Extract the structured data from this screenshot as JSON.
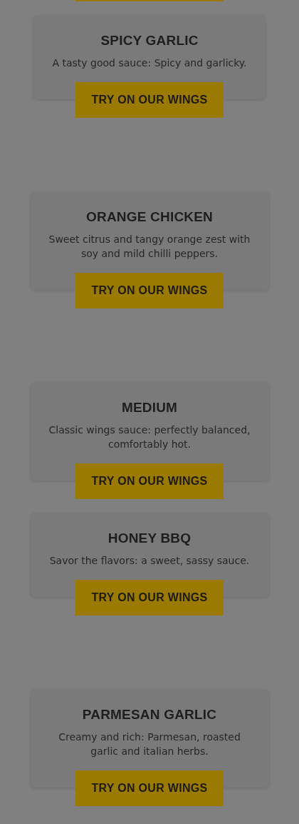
{
  "sauces": [
    {
      "name": "SPICY GARLIC",
      "description": "A tasty good sauce: Spicy and garlicky.",
      "button": "TRY ON OUR WINGS"
    },
    {
      "name": "ORANGE CHICKEN",
      "description": "Sweet citrus and tangy orange zest with soy and mild chilli peppers.",
      "button": "TRY ON OUR WINGS"
    },
    {
      "name": "MEDIUM",
      "description": "Classic wings sauce: perfectly balanced, comfortably hot.",
      "button": "TRY ON OUR WINGS"
    },
    {
      "name": "HONEY BBQ",
      "description": "Savor the flavors: a sweet, sassy sauce.",
      "button": "TRY ON OUR WINGS"
    },
    {
      "name": "PARMESAN GARLIC",
      "description": "Creamy and rich: Parmesan, roasted garlic and italian herbs.",
      "button": "TRY ON OUR WINGS"
    }
  ]
}
